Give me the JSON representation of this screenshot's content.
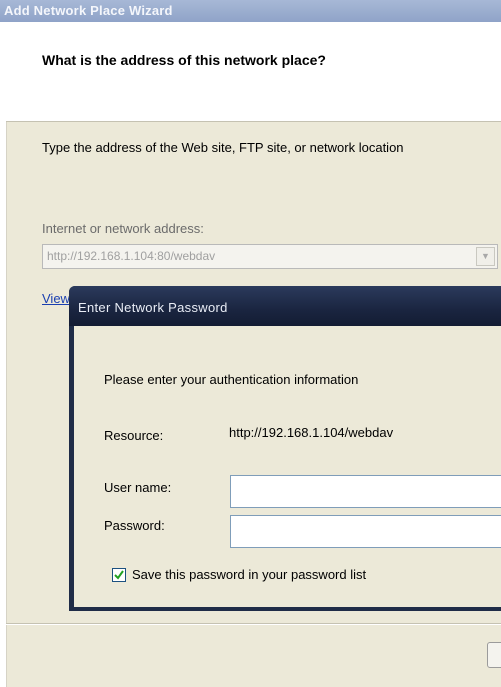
{
  "wizard": {
    "title": "Add Network Place Wizard",
    "heading": "What is the address of this network place?",
    "instruction": "Type the address of the Web site, FTP site, or network location",
    "address_label": "Internet or network address:",
    "address_value": "http://192.168.1.104:80/webdav",
    "view_link": "View"
  },
  "password_dialog": {
    "title": "Enter Network Password",
    "prompt": "Please enter your authentication information",
    "resource_label": "Resource:",
    "resource_value": "http://192.168.1.104/webdav",
    "username_label": "User name:",
    "username_value": "",
    "password_label": "Password:",
    "password_value": "",
    "save_password_label": "Save this password in your password list",
    "save_password_checked": true
  },
  "icons": {
    "dropdown": "chevron-down-icon",
    "checkbox": "checkmark-icon"
  },
  "colors": {
    "dialog_title_bg": "#1f2c47",
    "wizard_title_bg": "#8fa3c8",
    "link": "#1a3fb0",
    "dialog_body": "#ece9d8"
  }
}
